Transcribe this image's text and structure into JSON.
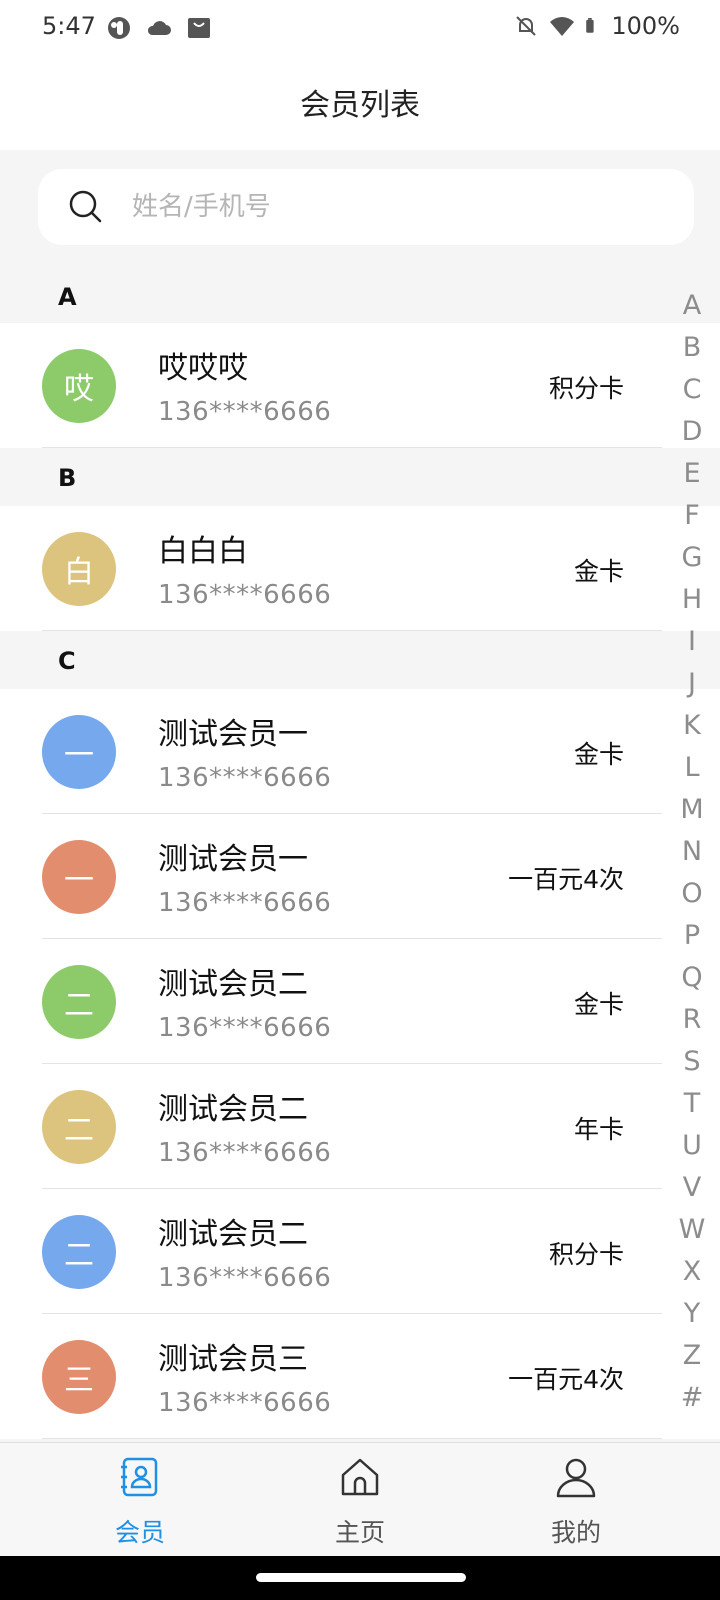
{
  "status_bar": {
    "time": "5:47",
    "battery": "100%",
    "icons": [
      "app-badge-icon",
      "cloud-icon",
      "shopping-bag-icon",
      "alarm-off-icon",
      "wifi-icon",
      "battery-icon"
    ]
  },
  "header": {
    "title": "会员列表"
  },
  "search": {
    "placeholder": "姓名/手机号",
    "value": ""
  },
  "sections": [
    {
      "letter": "A",
      "members": [
        {
          "avatar_char": "哎",
          "avatar_color": "#8dcb6a",
          "name": "哎哎哎",
          "phone": "136****6666",
          "card": "积分卡"
        }
      ]
    },
    {
      "letter": "B",
      "members": [
        {
          "avatar_char": "白",
          "avatar_color": "#dcc47e",
          "name": "白白白",
          "phone": "136****6666",
          "card": "金卡"
        }
      ]
    },
    {
      "letter": "C",
      "members": [
        {
          "avatar_char": "一",
          "avatar_color": "#75a8ec",
          "name": "测试会员一",
          "phone": "136****6666",
          "card": "金卡"
        },
        {
          "avatar_char": "一",
          "avatar_color": "#e38d6f",
          "name": "测试会员一",
          "phone": "136****6666",
          "card": "一百元4次"
        },
        {
          "avatar_char": "二",
          "avatar_color": "#8dcb6a",
          "name": "测试会员二",
          "phone": "136****6666",
          "card": "金卡"
        },
        {
          "avatar_char": "二",
          "avatar_color": "#dcc47e",
          "name": "测试会员二",
          "phone": "136****6666",
          "card": "年卡"
        },
        {
          "avatar_char": "二",
          "avatar_color": "#75a8ec",
          "name": "测试会员二",
          "phone": "136****6666",
          "card": "积分卡"
        },
        {
          "avatar_char": "三",
          "avatar_color": "#e38d6f",
          "name": "测试会员三",
          "phone": "136****6666",
          "card": "一百元4次"
        }
      ]
    }
  ],
  "index_letters": [
    "A",
    "B",
    "C",
    "D",
    "E",
    "F",
    "G",
    "H",
    "I",
    "J",
    "K",
    "L",
    "M",
    "N",
    "O",
    "P",
    "Q",
    "R",
    "S",
    "T",
    "U",
    "V",
    "W",
    "X",
    "Y",
    "Z",
    "#"
  ],
  "tabs": [
    {
      "label": "会员",
      "icon": "contacts-book-icon",
      "active": true
    },
    {
      "label": "主页",
      "icon": "home-icon",
      "active": false
    },
    {
      "label": "我的",
      "icon": "person-icon",
      "active": false
    }
  ],
  "colors": {
    "accent": "#1e90e6",
    "background": "#f5f5f5"
  }
}
